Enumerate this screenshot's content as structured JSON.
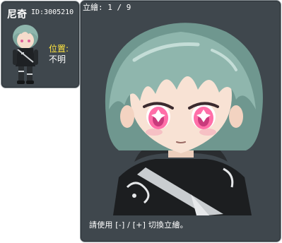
{
  "character": {
    "name": "尼奇",
    "id": "ID:3005210",
    "location_label": "位置:",
    "location_value": "不明"
  },
  "viewer": {
    "counter": "立繪: 1 / 9",
    "hint": "請使用 [-] / [+] 切換立繪。"
  },
  "colors": {
    "panel_bg": "#3f474d",
    "panel_border": "#8a9297",
    "hair": "#8fb6ad",
    "eyes": "#ff6fa8",
    "label_yellow": "#ffe640"
  },
  "icons": {
    "avatar": "character-sprite",
    "portrait": "character-illustration"
  }
}
